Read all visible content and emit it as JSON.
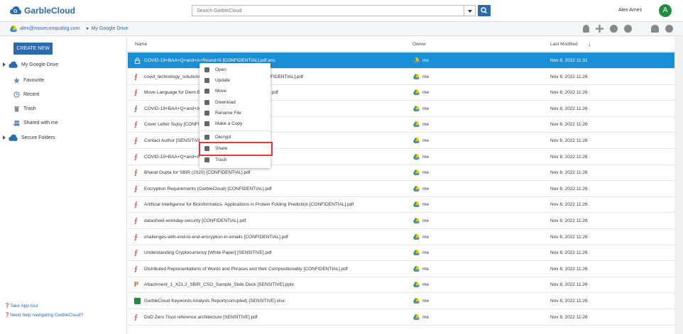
{
  "app": {
    "name": "GarbleCloud"
  },
  "search": {
    "placeholder": "Search GarbleCloud"
  },
  "user": {
    "name": "Alex Ames",
    "initial": "A"
  },
  "account": {
    "email": "alex@movecomputing.com",
    "drive": "My Google Drive"
  },
  "sidebar": {
    "create": "CREATE NEW",
    "items": [
      {
        "label": "My Google Drive"
      },
      {
        "label": "Favourite"
      },
      {
        "label": "Recent"
      },
      {
        "label": "Trash"
      },
      {
        "label": "Shared with me"
      },
      {
        "label": "Secure Folders"
      }
    ],
    "tour": "Take App tour",
    "help": "Need help navigating GarbleCloud?"
  },
  "columns": {
    "name": "Name",
    "owner": "Owner",
    "modified": "Last Modified"
  },
  "files": [
    {
      "name": "COVID-19+BAA+Q+and+A+Round+5 [CONFIDENTIAL].pdf.enc",
      "owner": "me",
      "date": "Nov 8, 2022 11:31"
    },
    {
      "name": "covid_technology_solutions",
      "suffix": "FIDENTIAL].pdf",
      "owner": "me",
      "date": "Nov 8, 2022 11:26"
    },
    {
      "name": "Move Language for Diem B",
      "suffix": ".pdf",
      "owner": "me",
      "date": "Nov 8, 2022 11:26"
    },
    {
      "name": "COVID-19+BAA+Q+and+A+",
      "suffix": "",
      "owner": "me",
      "date": "Nov 8, 2022 11:26"
    },
    {
      "name": "Cover Letter Sujoy [CONFID",
      "suffix": "",
      "owner": "me",
      "date": "Nov 8, 2022 11:26"
    },
    {
      "name": "Contact Author [SENSITIVE]",
      "suffix": "",
      "owner": "me",
      "date": "Nov 8, 2022 11:26"
    },
    {
      "name": "COVID-19+BAA+Q+and+A+",
      "suffix": "",
      "owner": "me",
      "date": "Nov 8, 2022 11:26"
    },
    {
      "name": "Bharat Gupta for SBIR (2020) [CONFIDENTIAL].pdf",
      "owner": "me",
      "date": "Nov 8, 2022 11:26"
    },
    {
      "name": "Encryption Requirements (GarbleCloud) [CONFIDENTIAL].pdf",
      "owner": "me",
      "date": "Nov 8, 2022 11:26"
    },
    {
      "name": "Artificial Intelligence for Bioinformatics- Applications in Protein Folding Prediction [CONFIDENTIAL].pdf",
      "owner": "me",
      "date": "Nov 8, 2022 11:26"
    },
    {
      "name": "datasheet-workday-security [CONFIDENTIAL].pdf",
      "owner": "me",
      "date": "Nov 8, 2022 11:26"
    },
    {
      "name": "challenges-with-end-to-end-encryption-in-emails [CONFIDENTIAL].pdf",
      "owner": "me",
      "date": "Nov 8, 2022 11:26"
    },
    {
      "name": "Understanding Cryptocurrency [White Paper] [SENSITIVE].pdf",
      "owner": "me",
      "date": "Nov 8, 2022 11:26"
    },
    {
      "name": "Distributed Representations of Words and Phrases and their Compositionality [CONFIDENTIAL].pdf",
      "owner": "me",
      "date": "Nov 8, 2022 11:26"
    },
    {
      "name": "Attachment_1_X21.2_SBIR_CSO_Sample_Slide Deck [SENSITIVE].pptx",
      "owner": "me",
      "date": "Nov 8, 2022 11:26"
    },
    {
      "name": "GarbleCloud Keywords Analysis Report(corrupted) [SENSITIVE].xlsx",
      "owner": "me",
      "date": "Nov 8, 2022 11:26"
    },
    {
      "name": "DoD Zero Trust reference architecture [SENSITIVE].pdf",
      "owner": "me",
      "date": "Nov 8, 2022 11:26"
    }
  ],
  "context_menu": [
    "Open",
    "Update",
    "Move",
    "Download",
    "Rename File",
    "Make a Copy",
    "Decrypt",
    "Share",
    "Trash"
  ],
  "colors": {
    "accent": "#2b6aad",
    "selected": "#1b8fd6",
    "highlight": "#e53935"
  }
}
